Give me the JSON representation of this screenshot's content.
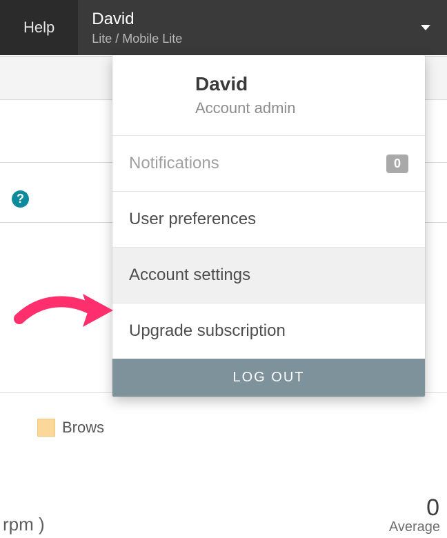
{
  "topbar": {
    "help_label": "Help",
    "user_primary": "David",
    "user_secondary": "Lite / Mobile Lite"
  },
  "dropdown": {
    "title": "David",
    "subtitle": "Account admin",
    "notifications": {
      "label": "Notifications",
      "count": "0"
    },
    "items": [
      {
        "label": "User preferences"
      },
      {
        "label": "Account settings",
        "highlight": true
      },
      {
        "label": "Upgrade subscription"
      }
    ],
    "logout_label": "LOG OUT"
  },
  "background": {
    "help_icon_char": "?",
    "legend_label": "Brows",
    "metric_left": "rpm )",
    "metric_value": "0",
    "metric_label": "Average"
  },
  "colors": {
    "accent_arrow": "#ff2f6d",
    "topbar_bg": "#2b2b2b"
  }
}
